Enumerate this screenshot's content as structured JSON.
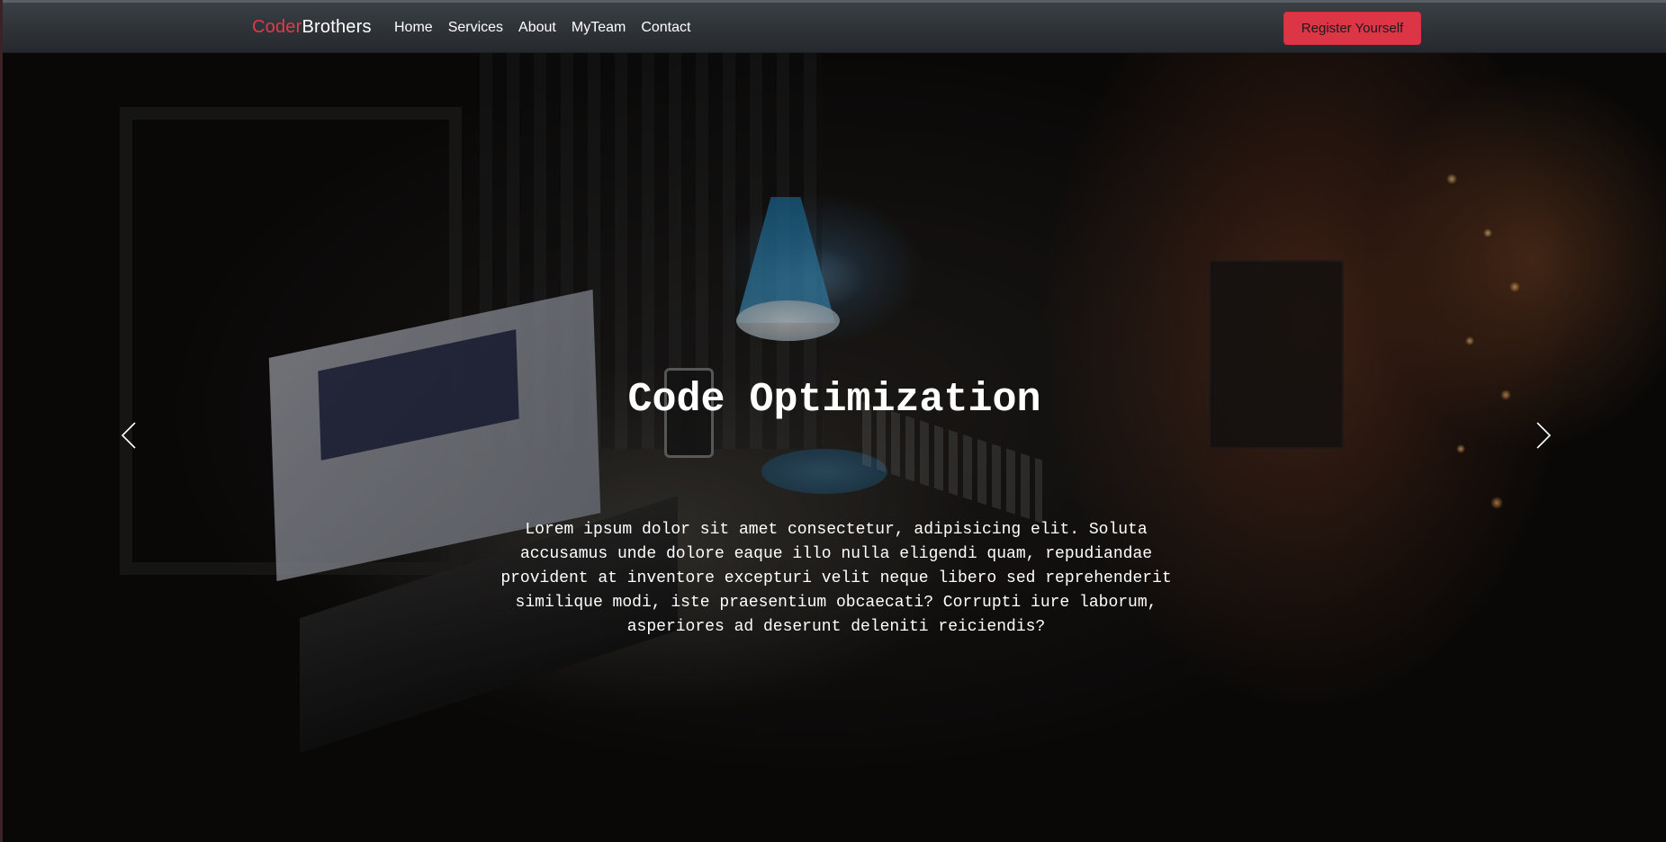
{
  "brand": {
    "part1": "Coder",
    "part2": "Brothers",
    "accent_color": "#e03a4a"
  },
  "nav": {
    "items": [
      {
        "label": "Home"
      },
      {
        "label": "Services"
      },
      {
        "label": "About"
      },
      {
        "label": "MyTeam"
      },
      {
        "label": "Contact"
      }
    ],
    "cta_label": "Register Yourself",
    "cta_color": "#dc3545"
  },
  "hero": {
    "title": "Code Optimization",
    "text": "Lorem ipsum dolor sit amet consectetur, adipisicing elit. Soluta accusamus unde dolore eaque illo nulla eligendi quam, repudiandae provident at inventore excepturi velit neque libero sed reprehenderit similique modi, iste praesentium obcaecati? Corrupti iure laborum, asperiores ad deserunt deleniti reiciendis?",
    "prev_icon": "chevron-left-icon",
    "next_icon": "chevron-right-icon"
  }
}
